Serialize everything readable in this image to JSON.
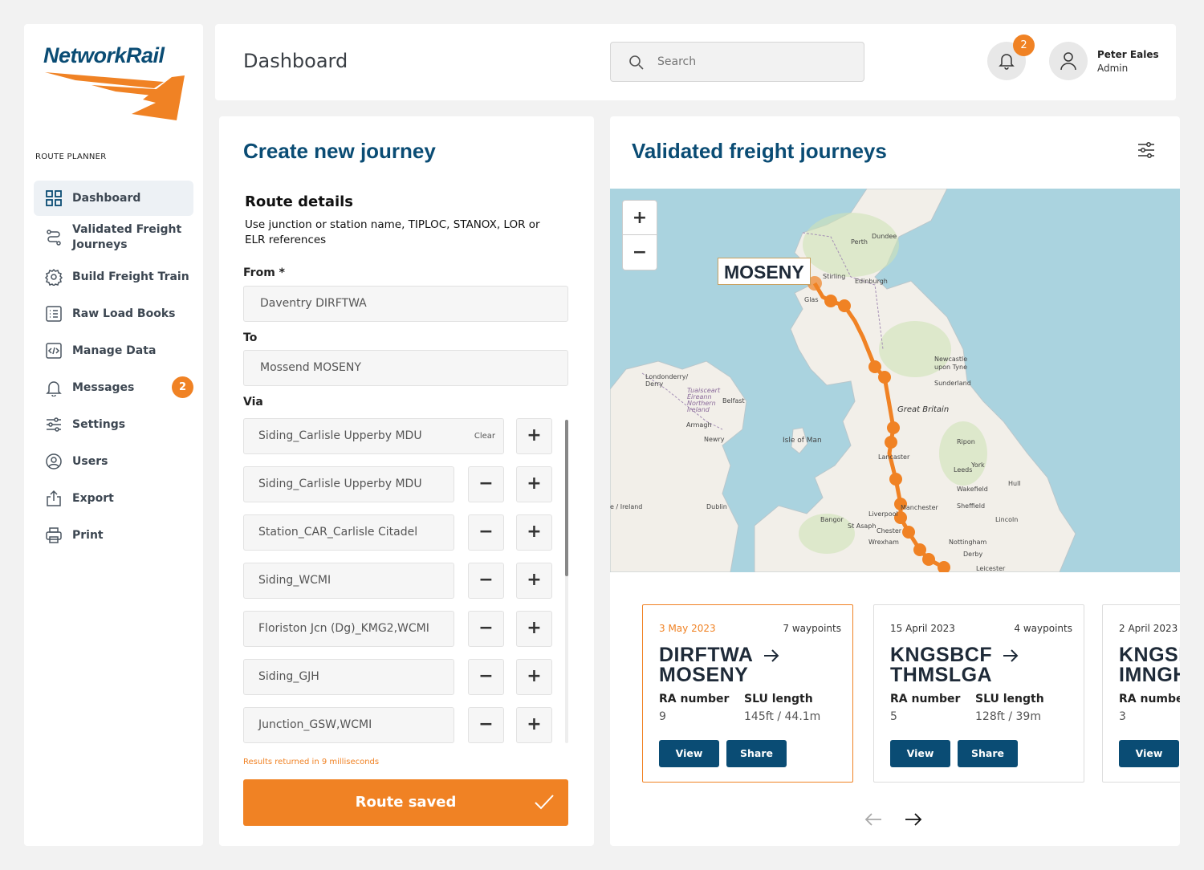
{
  "brand": {
    "logo_text": "NetworkRail"
  },
  "sidebar": {
    "section_label": "ROUTE PLANNER",
    "items": [
      {
        "label": "Dashboard",
        "icon": "grid-icon"
      },
      {
        "label": "Validated Freight\nJourneys",
        "icon": "route-icon"
      },
      {
        "label": "Build Freight Train",
        "icon": "gear-icon"
      },
      {
        "label": "Raw Load Books",
        "icon": "list-icon"
      },
      {
        "label": "Manage Data",
        "icon": "code-icon"
      },
      {
        "label": "Messages",
        "icon": "bell-icon",
        "badge": "2"
      },
      {
        "label": "Settings",
        "icon": "sliders-icon"
      },
      {
        "label": "Users",
        "icon": "user-circle-icon"
      },
      {
        "label": "Export",
        "icon": "export-icon"
      },
      {
        "label": "Print",
        "icon": "printer-icon"
      }
    ]
  },
  "header": {
    "title": "Dashboard",
    "search_placeholder": "Search",
    "notification_count": "2",
    "user_name": "Peter Eales",
    "user_role": "Admin"
  },
  "create": {
    "title": "Create new journey",
    "route_title": "Route details",
    "route_desc": "Use junction or station name, TIPLOC, STANOX, LOR or ELR references",
    "from_label": "From *",
    "from_value": "Daventry  DIRFTWA",
    "to_label": "To",
    "to_value": "Mossend  MOSENY",
    "via_label": "Via",
    "via": [
      {
        "value": "Siding_Carlisle Upperby MDU",
        "clear": "Clear"
      },
      {
        "value": "Siding_Carlisle Upperby MDU"
      },
      {
        "value": "Station_CAR_Carlisle Citadel"
      },
      {
        "value": "Siding_WCMI"
      },
      {
        "value": "Floriston Jcn (Dg)_KMG2,WCMI"
      },
      {
        "value": "Siding_GJH"
      },
      {
        "value": "Junction_GSW,WCMI"
      }
    ],
    "results_text": "Results returned in 9 milliseconds",
    "route_button": "Route saved"
  },
  "validated": {
    "title": "Validated freight journeys",
    "map": {
      "marker_label": "MOSENY",
      "zoom_in": "+",
      "zoom_out": "−",
      "places": [
        "Dundee",
        "Perth",
        "Stirling",
        "Edinburgh",
        "Glas",
        "Newcastle upon Tyne",
        "Sunderland",
        "Londonderry/ Derry",
        "Tuaisceart Éireann Northern Ireland",
        "Belfast",
        "Armagh",
        "Newry",
        "Isle of Man",
        "Great Britain",
        "Ripon",
        "York",
        "Leeds",
        "Wakefield",
        "Hull",
        "Lancaster",
        "Manchester",
        "Sheffield",
        "Liverpool",
        "Chester",
        "St Asaph",
        "Bangor",
        "Wrexham",
        "Lincoln",
        "Nottingham",
        "Derby",
        "Leicester",
        "Dublin",
        "Ireland"
      ]
    },
    "cards": [
      {
        "date": "3 May 2023",
        "waypoints": "7 waypoints",
        "from": "DIRFTWA",
        "to": "MOSENY",
        "ra_label": "RA number",
        "ra": "9",
        "slu_label": "SLU length",
        "slu": "145ft / 44.1m",
        "view": "View",
        "share": "Share"
      },
      {
        "date": "15 April 2023",
        "waypoints": "4 waypoints",
        "from": "KNGSBCF",
        "to": "THMSLGA",
        "ra_label": "RA number",
        "ra": "5",
        "slu_label": "SLU length",
        "slu": "128ft / 39m",
        "view": "View",
        "share": "Share"
      },
      {
        "date": "2 April 2023",
        "from": "KNGSI",
        "to": "IMNGH",
        "ra_label": "RA number",
        "ra": "3",
        "view": "View"
      }
    ]
  }
}
